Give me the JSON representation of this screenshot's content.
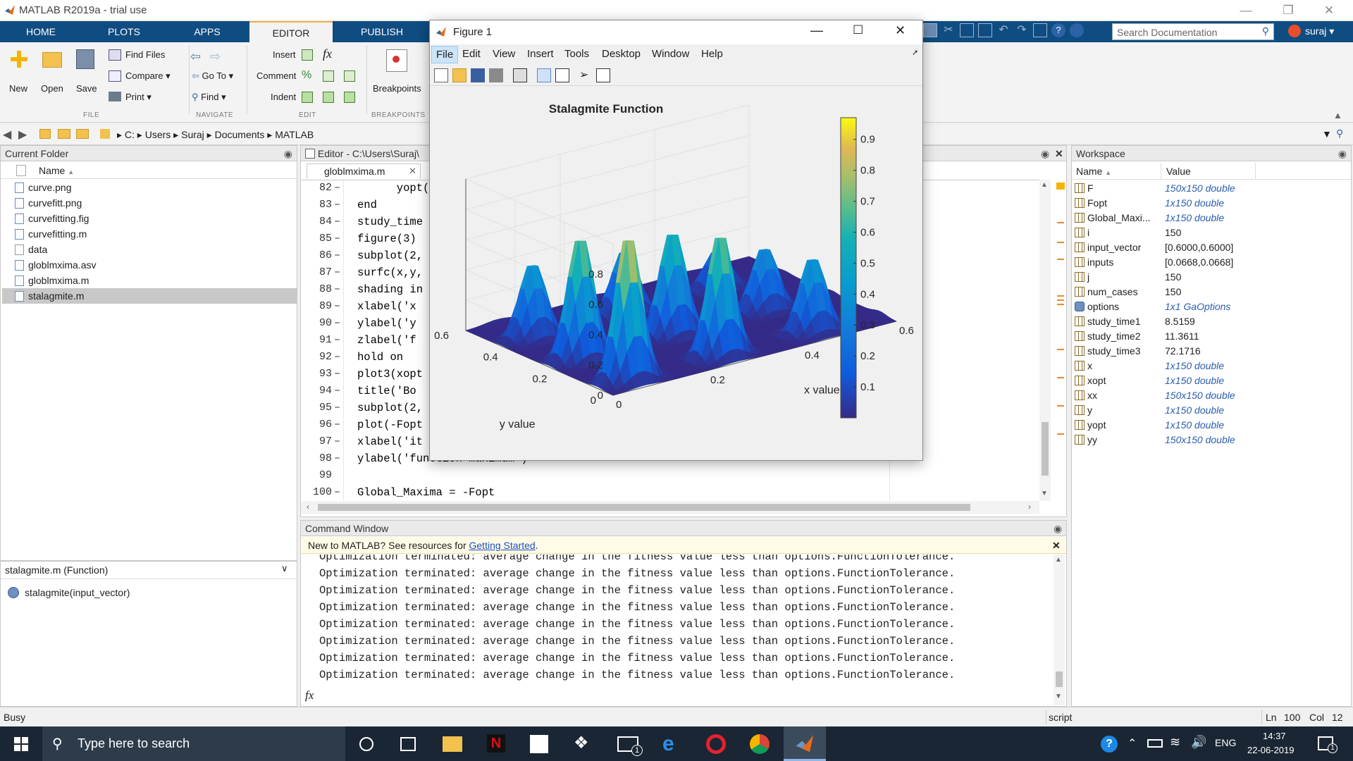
{
  "window": {
    "title": "MATLAB R2019a - trial use"
  },
  "tabs": [
    "HOME",
    "PLOTS",
    "APPS",
    "EDITOR",
    "PUBLISH"
  ],
  "search": {
    "placeholder": "Search Documentation"
  },
  "user": {
    "name": "suraj"
  },
  "ribbon": {
    "new": "New",
    "open": "Open",
    "save": "Save",
    "find_files": "Find Files",
    "compare": "Compare",
    "print": "Print",
    "go_to": "Go To",
    "find": "Find",
    "insert": "Insert",
    "comment": "Comment",
    "indent": "Indent",
    "breakpoints": "Breakpoints",
    "groups": {
      "file": "FILE",
      "navigate": "NAVIGATE",
      "edit": "EDIT",
      "breakpoints": "BREAKPOINTS"
    }
  },
  "path": [
    "C:",
    "Users",
    "Suraj",
    "Documents",
    "MATLAB"
  ],
  "current_folder": {
    "title": "Current Folder",
    "column": "Name",
    "files": [
      "curve.png",
      "curvefitt.png",
      "curvefitting.fig",
      "curvefitting.m",
      "data",
      "globlmxima.asv",
      "globlmxima.m",
      "stalagmite.m"
    ],
    "selected_file": "stalagmite.m",
    "detail_title": "stalagmite.m  (Function)",
    "detail_item": "stalagmite(input_vector)"
  },
  "editor": {
    "title": "Editor - C:\\Users\\Suraj\\",
    "tab": "globlmxima.m",
    "lines": [
      {
        "n": "82",
        "code": "      yopt(i"
      },
      {
        "n": "83",
        "code": "end"
      },
      {
        "n": "84",
        "code": "study_time"
      },
      {
        "n": "85",
        "code": "figure(3)"
      },
      {
        "n": "86",
        "code": "subplot(2,"
      },
      {
        "n": "87",
        "code": "surfc(x,y,"
      },
      {
        "n": "88",
        "code": "shading in"
      },
      {
        "n": "89",
        "code": "xlabel('x"
      },
      {
        "n": "90",
        "code": "ylabel('y"
      },
      {
        "n": "91",
        "code": "zlabel('f"
      },
      {
        "n": "92",
        "code": "hold on"
      },
      {
        "n": "93",
        "code": "plot3(xopt"
      },
      {
        "n": "94",
        "code": "title('Bo"
      },
      {
        "n": "95",
        "code": "subplot(2,"
      },
      {
        "n": "96",
        "code": "plot(-Fopt"
      },
      {
        "n": "97",
        "code": "xlabel('it"
      },
      {
        "n": "98",
        "code": "ylabel('function maximum')"
      },
      {
        "n": "99",
        "code": ""
      },
      {
        "n": "100",
        "code": "Global_Maxima = -Fopt"
      }
    ]
  },
  "command_window": {
    "title": "Command Window",
    "banner_text": "New to MATLAB? See resources for ",
    "banner_link": "Getting Started",
    "banner_end": ".",
    "lines": [
      "Optimization terminated: average change in the fitness value less than options.FunctionTolerance.",
      "Optimization terminated: average change in the fitness value less than options.FunctionTolerance.",
      "Optimization terminated: average change in the fitness value less than options.FunctionTolerance.",
      "Optimization terminated: average change in the fitness value less than options.FunctionTolerance.",
      "Optimization terminated: average change in the fitness value less than options.FunctionTolerance.",
      "Optimization terminated: average change in the fitness value less than options.FunctionTolerance.",
      "Optimization terminated: average change in the fitness value less than options.FunctionTolerance.",
      "Optimization terminated: average change in the fitness value less than options.FunctionTolerance."
    ],
    "prompt": "fx"
  },
  "workspace": {
    "title": "Workspace",
    "col_name": "Name",
    "col_value": "Value",
    "vars": [
      {
        "name": "F",
        "value": "150x150 double",
        "italic": true
      },
      {
        "name": "Fopt",
        "value": "1x150 double",
        "italic": true
      },
      {
        "name": "Global_Maxi...",
        "value": "1x150 double",
        "italic": true
      },
      {
        "name": "i",
        "value": "150",
        "italic": false
      },
      {
        "name": "input_vector",
        "value": "[0.6000,0.6000]",
        "italic": false
      },
      {
        "name": "inputs",
        "value": "[0.0668,0.0668]",
        "italic": false
      },
      {
        "name": "j",
        "value": "150",
        "italic": false
      },
      {
        "name": "num_cases",
        "value": "150",
        "italic": false
      },
      {
        "name": "options",
        "value": "1x1 GaOptions",
        "italic": true
      },
      {
        "name": "study_time1",
        "value": "8.5159",
        "italic": false
      },
      {
        "name": "study_time2",
        "value": "11.3611",
        "italic": false
      },
      {
        "name": "study_time3",
        "value": "72.1716",
        "italic": false
      },
      {
        "name": "x",
        "value": "1x150 double",
        "italic": true
      },
      {
        "name": "xopt",
        "value": "1x150 double",
        "italic": true
      },
      {
        "name": "xx",
        "value": "150x150 double",
        "italic": true
      },
      {
        "name": "y",
        "value": "1x150 double",
        "italic": true
      },
      {
        "name": "yopt",
        "value": "1x150 double",
        "italic": true
      },
      {
        "name": "yy",
        "value": "150x150 double",
        "italic": true
      }
    ]
  },
  "status": {
    "left": "Busy",
    "mode": "script",
    "ln_label": "Ln",
    "ln": "100",
    "col_label": "Col",
    "col": "12"
  },
  "taskbar": {
    "search_placeholder": "Type here to search",
    "lang": "ENG",
    "time": "14:37",
    "date": "22-06-2019",
    "mail_badge": "1",
    "notif_badge": "1"
  },
  "figure": {
    "title": "Figure 1",
    "menu": [
      "File",
      "Edit",
      "View",
      "Insert",
      "Tools",
      "Desktop",
      "Window",
      "Help"
    ]
  },
  "chart_data": {
    "type": "surface",
    "title": "Stalagmite Function",
    "xlabel": "x value",
    "ylabel": "y value",
    "zlabel": "",
    "xlim": [
      0,
      0.6
    ],
    "ylim": [
      0,
      0.6
    ],
    "zlim": [
      0,
      1
    ],
    "x_ticks": [
      "0",
      "0.2",
      "0.4",
      "0.6"
    ],
    "y_ticks": [
      "0",
      "0.2",
      "0.4",
      "0.6"
    ],
    "z_ticks": [
      "0",
      "0.2",
      "0.4",
      "0.6",
      "0.8"
    ],
    "colorbar_ticks": [
      "0.1",
      "0.2",
      "0.3",
      "0.4",
      "0.5",
      "0.6",
      "0.7",
      "0.8",
      "0.9"
    ],
    "colormap": "parula",
    "shading": "interp",
    "peak_centers": [
      0.042,
      0.132,
      0.252,
      0.393,
      0.557
    ],
    "peak_heights": [
      0.3,
      0.55,
      0.75,
      0.88,
      1.0
    ]
  }
}
